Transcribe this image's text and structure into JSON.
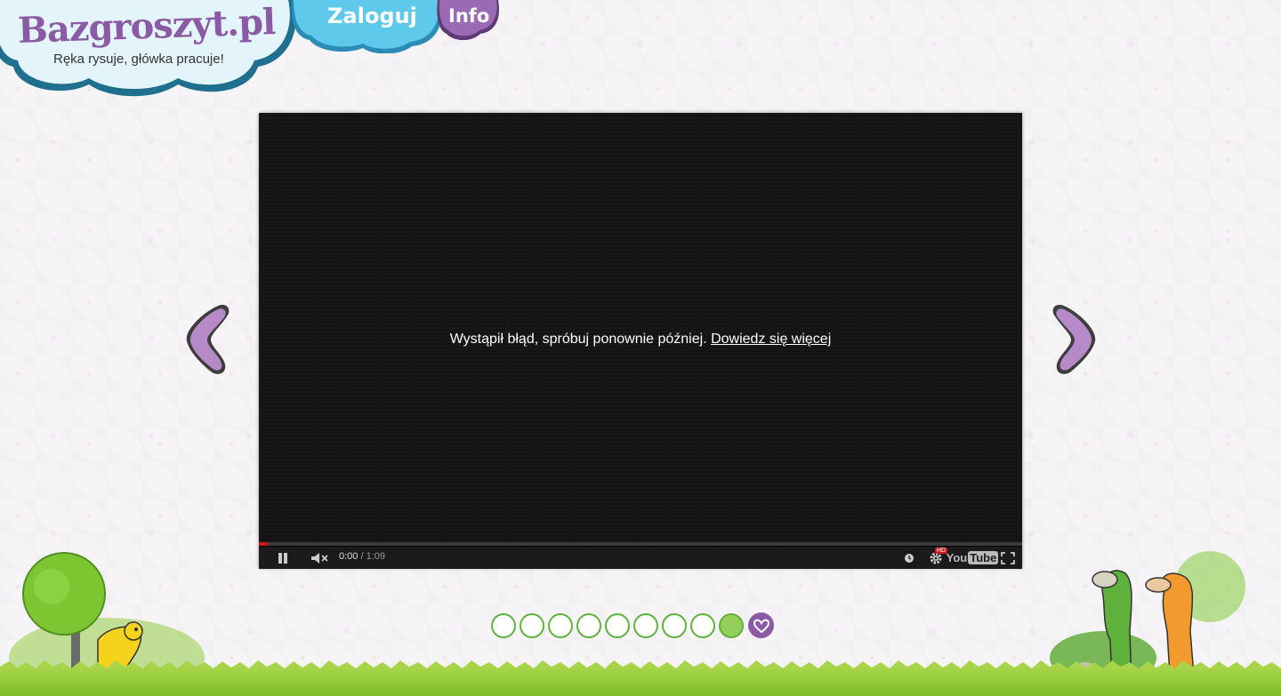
{
  "header": {
    "logo_text": "Bazgroszyt.pl",
    "tagline": "Ręka rysuje, główka pracuje!",
    "login_label": "Zaloguj",
    "info_label": "Info"
  },
  "player": {
    "error_text": "Wystąpił błąd, spróbuj ponownie później.",
    "error_link": "Dowiedz się więcej",
    "current_time": "0:00",
    "duration": "/ 1:09",
    "progress_fraction": 0.012,
    "hd_label": "HD",
    "youtube_you": "You",
    "youtube_tube": "Tube"
  },
  "pagination": {
    "count": 9,
    "active_index": 8
  },
  "colors": {
    "purple": "#8b5aa4",
    "cloud_blue": "#5ec9ea",
    "green": "#5fb13b",
    "progress_red": "#cc181e"
  }
}
